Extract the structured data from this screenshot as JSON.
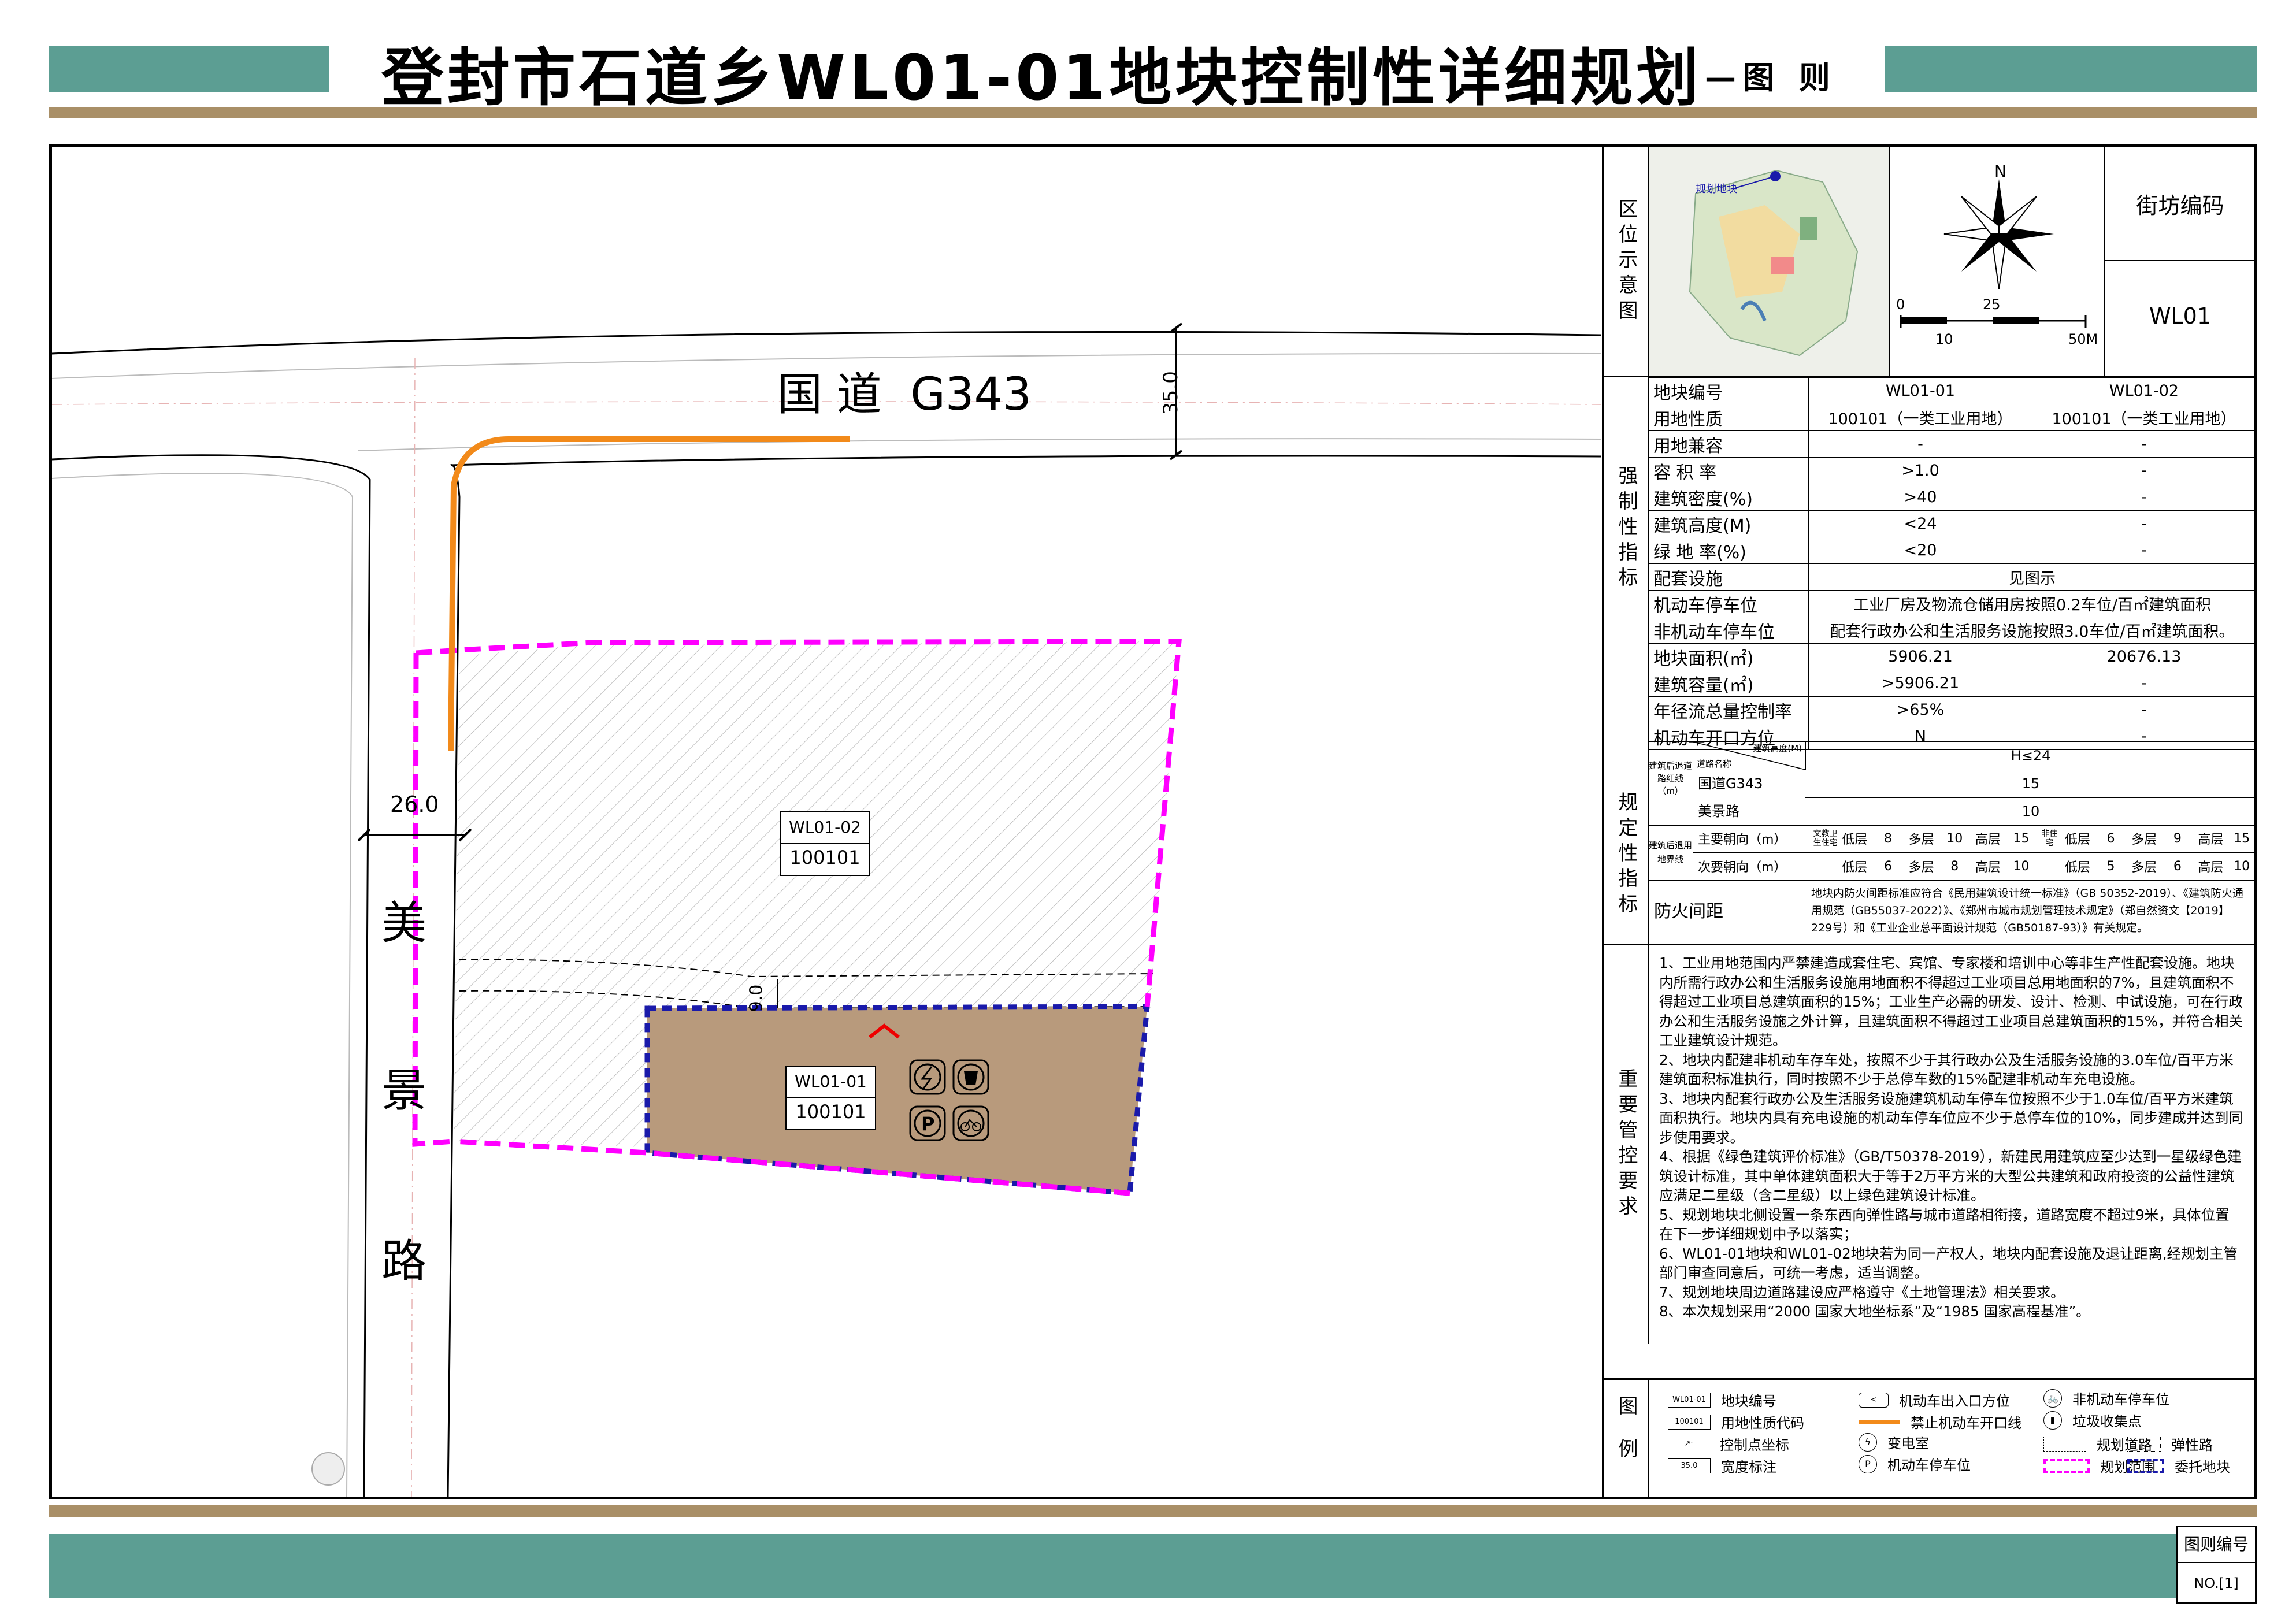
{
  "header": {
    "title": "登封市石道乡WL01-01地块控制性详细规划",
    "subtitle": "—图 则"
  },
  "colors": {
    "teal_band": "#5c9e93",
    "gold_band": "#a98f67",
    "plot_fill": "#b89a7c",
    "boundary_magenta": "#ff00ff",
    "entrust_blue": "#1a1aaa",
    "no_entry_orange": "#f28a1a"
  },
  "map": {
    "road_north": "国 道  G343",
    "road_west": [
      "美",
      "景",
      "路"
    ],
    "width_north": "35.0",
    "width_west": "26.0",
    "setback": "9.0",
    "plot_a": {
      "code": "WL01-02",
      "use": "100101"
    },
    "plot_b": {
      "code": "WL01-01",
      "use": "100101"
    },
    "facility_icons": [
      "power-substation-icon",
      "trash-collection-icon",
      "parking-icon",
      "bicycle-parking-icon"
    ]
  },
  "location": {
    "label": "区位示意图",
    "marker": "规划地块",
    "north": "N",
    "scale": [
      "0",
      "25",
      "10",
      "50M"
    ],
    "block_code_label": "街坊编码",
    "block_code": "WL01"
  },
  "indicators": {
    "header": [
      "地块编号",
      "WL01-01",
      "WL01-02"
    ],
    "mandatory_label": "强制性指标",
    "mandatory": [
      [
        "用地性质",
        "100101（一类工业用地）",
        "100101（一类工业用地）"
      ],
      [
        "用地兼容",
        "-",
        "-"
      ],
      [
        "容 积 率",
        ">1.0",
        "-"
      ],
      [
        "建筑密度(%)",
        ">40",
        "-"
      ],
      [
        "建筑高度(M)",
        "<24",
        "-"
      ],
      [
        "绿 地 率(%)",
        "<20",
        "-"
      ]
    ],
    "mandatory_wide": [
      [
        "配套设施",
        "见图示"
      ],
      [
        "机动车停车位",
        "工业厂房及物流仓储用房按照0.2车位/百㎡建筑面积"
      ],
      [
        "非机动车停车位",
        "配套行政办公和生活服务设施按照3.0车位/百㎡建筑面积。"
      ]
    ],
    "regulatory_label": "规定性指标",
    "regulatory": [
      [
        "地块面积(㎡)",
        "5906.21",
        "20676.13"
      ],
      [
        "建筑容量(㎡)",
        ">5906.21",
        "-"
      ],
      [
        "年径流总量控制率",
        ">65%",
        "-"
      ],
      [
        "机动车开口方位",
        "N",
        "-"
      ]
    ],
    "setback_road": {
      "side": "建筑后退道路红线（m）",
      "diag_top": "建筑高度(M)",
      "diag_bottom": "道路名称",
      "height": "H≤24",
      "rows": [
        [
          "国道G343",
          "15"
        ],
        [
          "美景路",
          "10"
        ]
      ]
    },
    "setback_land": {
      "side": "建筑后退用地界线",
      "rows": [
        [
          "主要朝向（m）",
          "文教卫生住宅",
          "低层",
          "8",
          "多层",
          "10",
          "高层",
          "15",
          "非住宅",
          "低层",
          "6",
          "多层",
          "9",
          "高层",
          "15"
        ],
        [
          "次要朝向（m）",
          "",
          "低层",
          "6",
          "多层",
          "8",
          "高层",
          "10",
          "",
          "低层",
          "5",
          "多层",
          "6",
          "高层",
          "10"
        ]
      ]
    },
    "fire": {
      "label": "防火间距",
      "text": "地块内防火间距标准应符合《民用建筑设计统一标准》（GB 50352-2019）、《建筑防火通用规范（GB55037-2022）》、《郑州市城市规划管理技术规定》（郑自然资文【2019】229号）和《工业企业总平面设计规范（GB50187-93）》有关规定。"
    }
  },
  "requirements": {
    "label": "重要管控要求",
    "items": [
      "1、工业用地范围内严禁建造成套住宅、宾馆、专家楼和培训中心等非生产性配套设施。地块内所需行政办公和生活服务设施用地面积不得超过工业项目总用地面积的7%，且建筑面积不得超过工业项目总建筑面积的15%；工业生产必需的研发、设计、检测、中试设施，可在行政办公和生活服务设施之外计算，且建筑面积不得超过工业项目总建筑面积的15%，并符合相关工业建筑设计规范。",
      "2、地块内配建非机动车存车处，按照不少于其行政办公及生活服务设施的3.0车位/百平方米建筑面积标准执行，同时按照不少于总停车数的15%配建非机动车充电设施。",
      "3、地块内配套行政办公及生活服务设施建筑机动车停车位按照不少于1.0车位/百平方米建筑面积执行。地块内具有充电设施的机动车停车位应不少于总停车位的10%，同步建成并达到同步使用要求。",
      "4、根据《绿色建筑评价标准》（GB/T50378-2019），新建民用建筑应至少达到一星级绿色建筑设计标准，其中单体建筑面积大于等于2万平方米的大型公共建筑和政府投资的公益性建筑应满足二星级（含二星级）以上绿色建筑设计标准。",
      "5、规划地块北侧设置一条东西向弹性路与城市道路相衔接，道路宽度不超过9米，具体位置在下一步详细规划中予以落实；",
      "6、WL01-01地块和WL01-02地块若为同一产权人，地块内配套设施及退让距离,经规划主管部门审查同意后，可统一考虑，适当调整。",
      "7、规划地块周边道路建设应严格遵守《土地管理法》相关要求。",
      "8、本次规划采用“2000 国家大地坐标系”及“1985 国家高程基准”。"
    ]
  },
  "legend": {
    "label": "图例",
    "items": [
      {
        "sym": "WL01-01",
        "text": "地块编号"
      },
      {
        "sym": "<",
        "text": "机动车出入口方位"
      },
      {
        "sym": "bike",
        "text": "非机动车停车位"
      },
      {
        "sym": "100101",
        "text": "用地性质代码"
      },
      {
        "sym": "orange",
        "text": "禁止机动车开口线"
      },
      {
        "sym": "trash",
        "text": "垃圾收集点"
      },
      {
        "sym": "pt",
        "text": "控制点坐标"
      },
      {
        "sym": "power",
        "text": "变电室"
      },
      {
        "sym": "road",
        "text": "规划道路"
      },
      {
        "sym": "flex",
        "text": "弹性路"
      },
      {
        "sym": "35.0",
        "text": "宽度标注"
      },
      {
        "sym": "P",
        "text": "机动车停车位"
      },
      {
        "sym": "magenta",
        "text": "规划范围"
      },
      {
        "sym": "blue",
        "text": "委托地块"
      }
    ]
  },
  "footer": {
    "drawing_no_label": "图则编号",
    "drawing_no": "NO.[1]"
  }
}
